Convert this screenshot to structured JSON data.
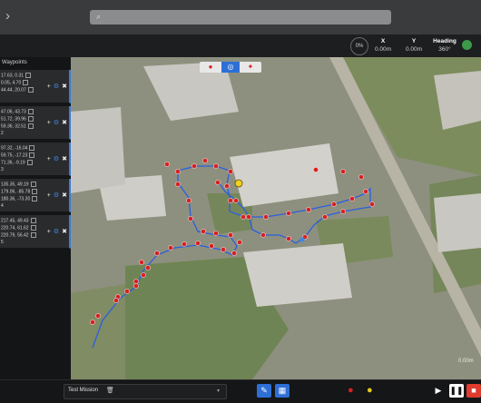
{
  "topbar": {
    "back_icon": "chevron-right-icon",
    "search_icon": "search-icon",
    "search_placeholder": ""
  },
  "status": {
    "battery": "0%",
    "x_label": "X",
    "x_value": "0.00m",
    "y_label": "Y",
    "y_value": "0.00m",
    "heading_label": "Heading",
    "heading_value": "360°",
    "connection_color": "#3c9a4a"
  },
  "sidebar": {
    "title": "Waypoints",
    "items": [
      {
        "lines": [
          "17.63, 0.31",
          "0.05, 4.70",
          "44.44, 20.07"
        ],
        "tail": ""
      },
      {
        "lines": [
          "47.06, 43.73",
          "51.72, 39.96",
          "59.36, 32.51"
        ],
        "tail": "2"
      },
      {
        "lines": [
          "97.32, -16.04",
          "59.75, -17.23",
          "71.36, -9.19"
        ],
        "tail": "3"
      },
      {
        "lines": [
          "135.35, 49.19",
          "179.06, -85.78",
          "180.36, -73.30"
        ],
        "tail": "4"
      },
      {
        "lines": [
          "217.45, 49.43",
          "220.74, 61.62",
          "220.79, 56.42"
        ],
        "tail": "5"
      }
    ]
  },
  "map": {
    "scale": "0.00m",
    "tools": [
      "pin-red-icon",
      "target-icon",
      "route-icon"
    ],
    "active_tool": 1
  },
  "bottom": {
    "mission_name": "Test Mission",
    "edit_icon": "pencil-icon",
    "grid_icon": "grid-icon",
    "pin_red": "map-pin-red-icon",
    "pin_yellow": "map-pin-yellow-icon",
    "play": "play-icon",
    "pause": "pause-icon",
    "stop": "stop-icon"
  },
  "colors": {
    "accent": "#2e6fd6",
    "route": "#2b5fe0",
    "waypoint": "#d62020",
    "stop": "#e03b2f"
  }
}
